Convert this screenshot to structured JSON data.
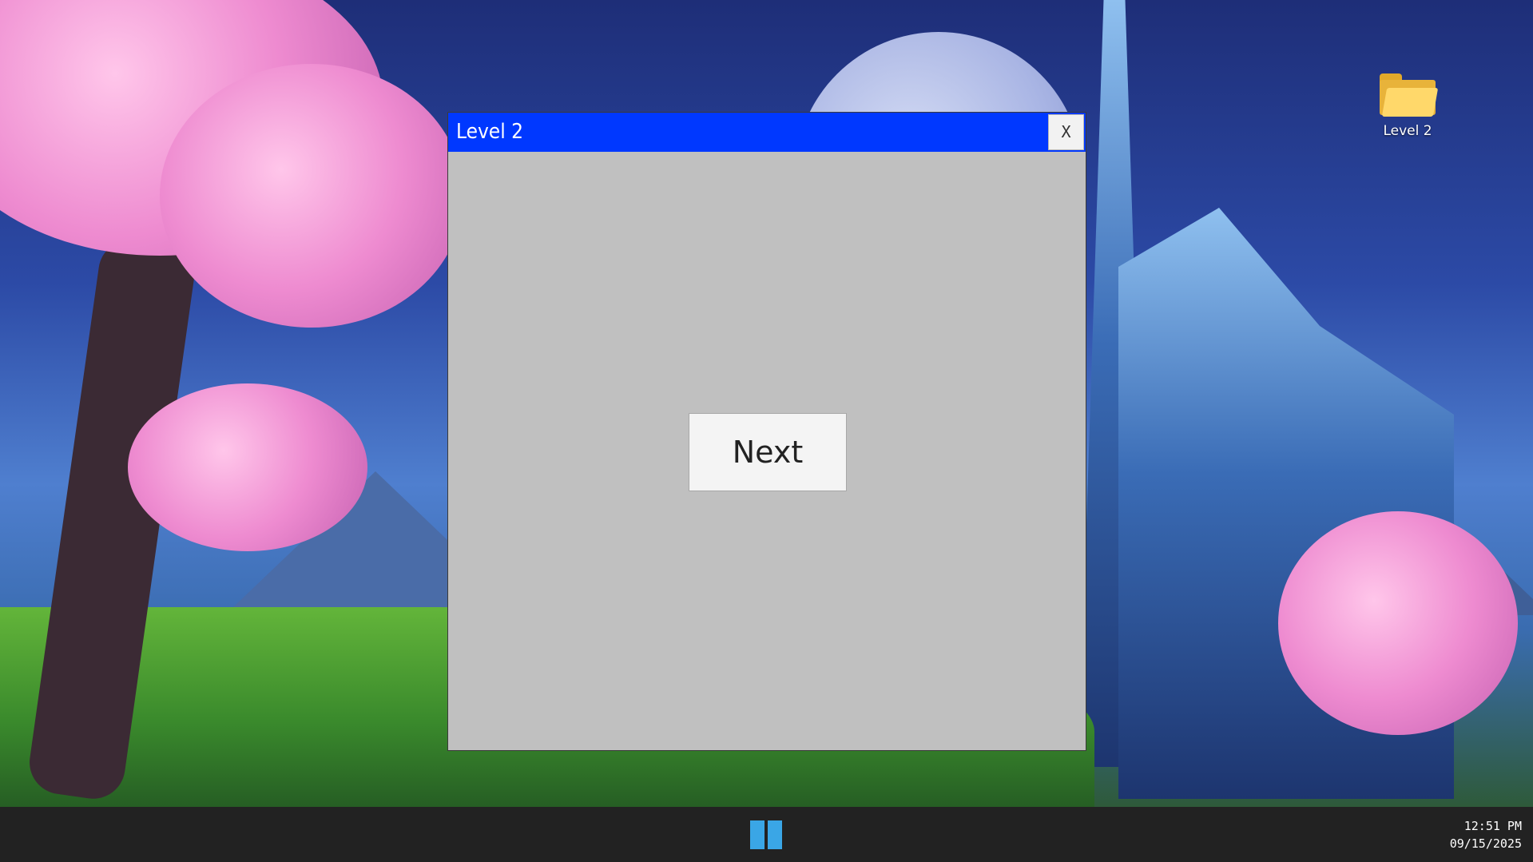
{
  "desktop": {
    "icons": [
      {
        "label": "Level 2",
        "icon": "folder-icon"
      }
    ]
  },
  "window": {
    "title": "Level 2",
    "close_label": "X",
    "next_label": "Next",
    "titlebar_color": "#0038ff",
    "body_color": "#c0c0c0"
  },
  "taskbar": {
    "start_icon": "pause-icon",
    "start_color": "#3aa6e6",
    "time": "12:51 PM",
    "date": "09/15/2025"
  }
}
